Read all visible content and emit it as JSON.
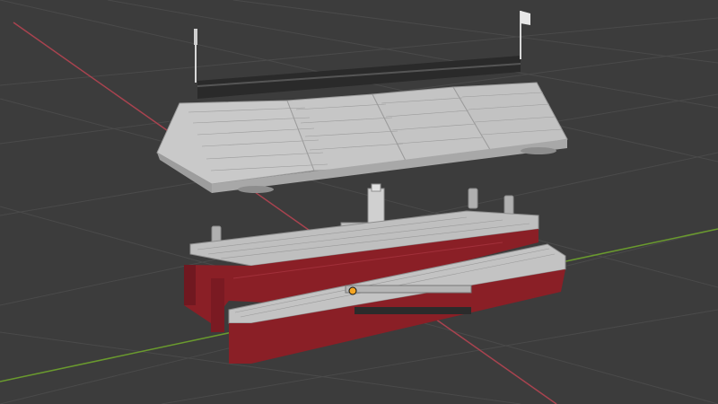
{
  "viewport": {
    "background": "#3c3c3c",
    "grid_color": "#4a4a4a",
    "x_axis_color": "#a8434f",
    "y_axis_color": "#6a9a2e",
    "origin_color": "#f5a623"
  },
  "scene": {
    "objects": [
      {
        "name": "roof-canopy",
        "color": "#c9c9c9"
      },
      {
        "name": "roof-rail",
        "color": "#2a2a2a"
      },
      {
        "name": "flag-left",
        "color": "#d8d8d8"
      },
      {
        "name": "flag-right",
        "color": "#e8e8e8"
      },
      {
        "name": "platform-deck",
        "color": "#bfbfbf"
      },
      {
        "name": "platform-base",
        "color": "#8a1f26"
      },
      {
        "name": "front-rail-block",
        "color": "#c3c3c3"
      },
      {
        "name": "pylons",
        "color": "#b0b0b0"
      },
      {
        "name": "console-tower",
        "color": "#d0d0d0"
      }
    ]
  }
}
